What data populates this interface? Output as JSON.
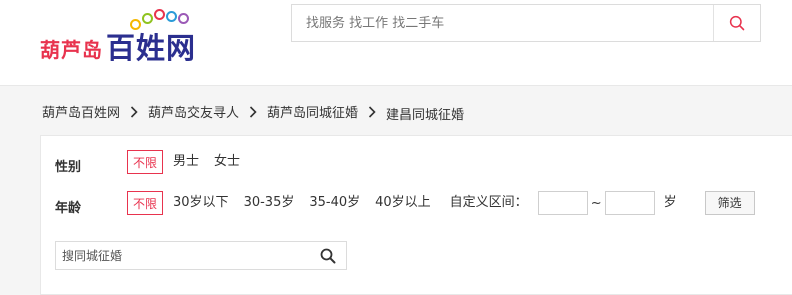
{
  "logo": {
    "city": "葫芦岛",
    "brand": "百姓网",
    "dot_colors": [
      "#f5b800",
      "#8fc31f",
      "#e8334e",
      "#2b9bd8",
      "#9b59b6"
    ]
  },
  "search": {
    "placeholder": "找服务 找工作 找二手车",
    "icon": "search-icon",
    "accent_color": "#e8334e"
  },
  "breadcrumb": {
    "items": [
      "葫芦岛百姓网",
      "葫芦岛交友寻人",
      "葫芦岛同城征婚",
      "建昌同城征婚"
    ],
    "separator": ">"
  },
  "filters": {
    "gender": {
      "label": "性别",
      "options": [
        "不限",
        "男士",
        "女士"
      ],
      "selected": "不限"
    },
    "age": {
      "label": "年龄",
      "options": [
        "不限",
        "30岁以下",
        "30-35岁",
        "35-40岁",
        "40岁以上"
      ],
      "selected": "不限",
      "custom_label": "自定义区间：",
      "range_separator": "~",
      "unit": "岁",
      "filter_button": "筛选"
    }
  },
  "sub_search": {
    "placeholder": "搜同城征婚",
    "icon": "search-icon"
  },
  "colors": {
    "accent": "#e8334e",
    "brand": "#2b2f8f"
  }
}
